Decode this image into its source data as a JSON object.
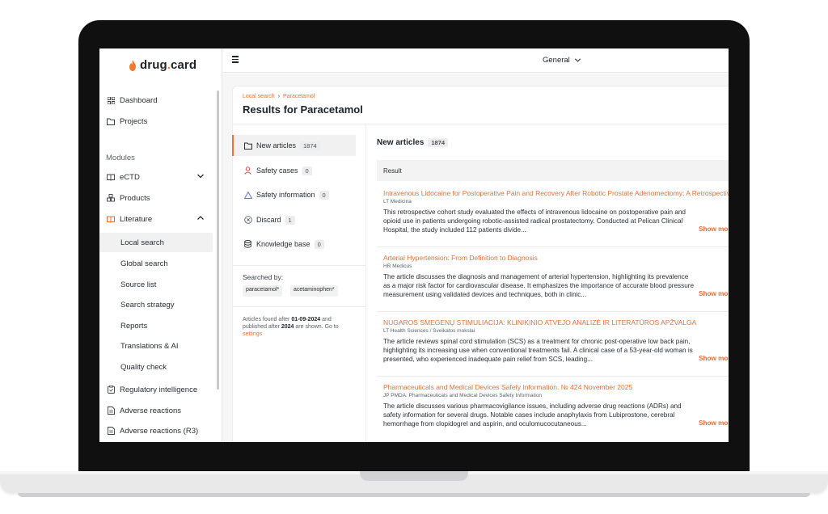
{
  "app": {
    "logo_text_a": "drug",
    "logo_dot": ".",
    "logo_text_b": "card"
  },
  "sidebar": {
    "top_items": [
      {
        "label": "Dashboard",
        "icon": "grid-icon"
      },
      {
        "label": "Projects",
        "icon": "folder-icon"
      }
    ],
    "modules_label": "Modules",
    "modules": [
      {
        "label": "eCTD",
        "icon": "book-icon",
        "expanded": false
      },
      {
        "label": "Products",
        "icon": "box-icon"
      },
      {
        "label": "Literature",
        "icon": "open-book-icon",
        "expanded": true
      }
    ],
    "literature_items": [
      {
        "label": "Local search",
        "active": true
      },
      {
        "label": "Global search"
      },
      {
        "label": "Source list"
      },
      {
        "label": "Search strategy"
      },
      {
        "label": "Reports"
      },
      {
        "label": "Translations & AI"
      },
      {
        "label": "Quality check"
      }
    ],
    "bottom_items": [
      {
        "label": "Regulatory intelligence",
        "icon": "clipboard-icon"
      },
      {
        "label": "Adverse reactions",
        "icon": "document-icon"
      },
      {
        "label": "Adverse reactions (R3)",
        "icon": "document-icon"
      }
    ]
  },
  "topbar": {
    "workspace": "General"
  },
  "breadcrumb": {
    "items": [
      "Local search",
      "Paracetamol"
    ]
  },
  "page_title": "Results for Paracetamol",
  "categories": [
    {
      "label": "New articles",
      "count": "1874",
      "icon": "folder-icon",
      "active": true
    },
    {
      "label": "Safety cases",
      "count": "0",
      "icon": "person-icon"
    },
    {
      "label": "Safety information",
      "count": "0",
      "icon": "warning-icon"
    },
    {
      "label": "Discard",
      "count": "1",
      "icon": "x-circle-icon"
    },
    {
      "label": "Knowledge base",
      "count": "0",
      "icon": "database-icon"
    }
  ],
  "searched": {
    "label": "Searched by:",
    "terms": [
      "paracetamol*",
      "acetaminophen*"
    ]
  },
  "note": {
    "part1": "Articles found after ",
    "date": "01-09-2024",
    "part2": " and published after ",
    "year": "2024",
    "part3": " are shown. Go to ",
    "link": "settings"
  },
  "results": {
    "title": "New articles",
    "count": "1874",
    "column": "Result",
    "show_more": "Show more",
    "items": [
      {
        "title": "Intravenous Lidocaine for Postoperative Pain and Recovery After Robotic Prostate Adenomectomy: A Retrospective Cohort Study",
        "source": "LT Medicina",
        "text": "This retrospective cohort study evaluated the effects of intravenous lidocaine on postoperative pain and opioid use in patients undergoing robotic-assisted radical prostatectomy. Conducted at Pelican Clinical Hospital, the study included 112 patients divide..."
      },
      {
        "title": "Arterial Hypertension: From Definition to Diagnosis",
        "source": "HR Medicus",
        "text": "The article discusses the diagnosis and management of arterial hypertension, highlighting its prevalence as a major risk factor for cardiovascular disease. It emphasizes the importance of accurate blood pressure measurement using validated devices and techniques, both in clinic..."
      },
      {
        "title": "NUGAROS SMEGENŲ STIMULIACIJA: KLINIKINIO ATVEJO ANALIZĖ IR LITERATŪROS APŽVALGA",
        "source": "LT Health Sciences / Sveikatos mokslai",
        "text": "The article reviews spinal cord stimulation (SCS) as a treatment for chronic post-operative low back pain, highlighting its increasing use when conventional treatments fail. A clinical case of a 53-year-old woman is presented, who experienced inadequate pain relief from SCS, leading..."
      },
      {
        "title": "Pharmaceuticals and Medical Devices Safety Information. № 424 November 2025",
        "source": "JP PMDA: Pharmaceuticals and Medical Devices Safety Information",
        "text": "The article discusses various pharmacovigilance issues, including adverse drug reactions (ADRs) and safety information for several drugs. Notable cases include anaphylaxis from Lubiprostone, cerebral hemorrhage from clopidogrel and aspirin, and oculomucocutaneous..."
      }
    ]
  },
  "colors": {
    "accent": "#e8703a",
    "frame": "#101010"
  }
}
